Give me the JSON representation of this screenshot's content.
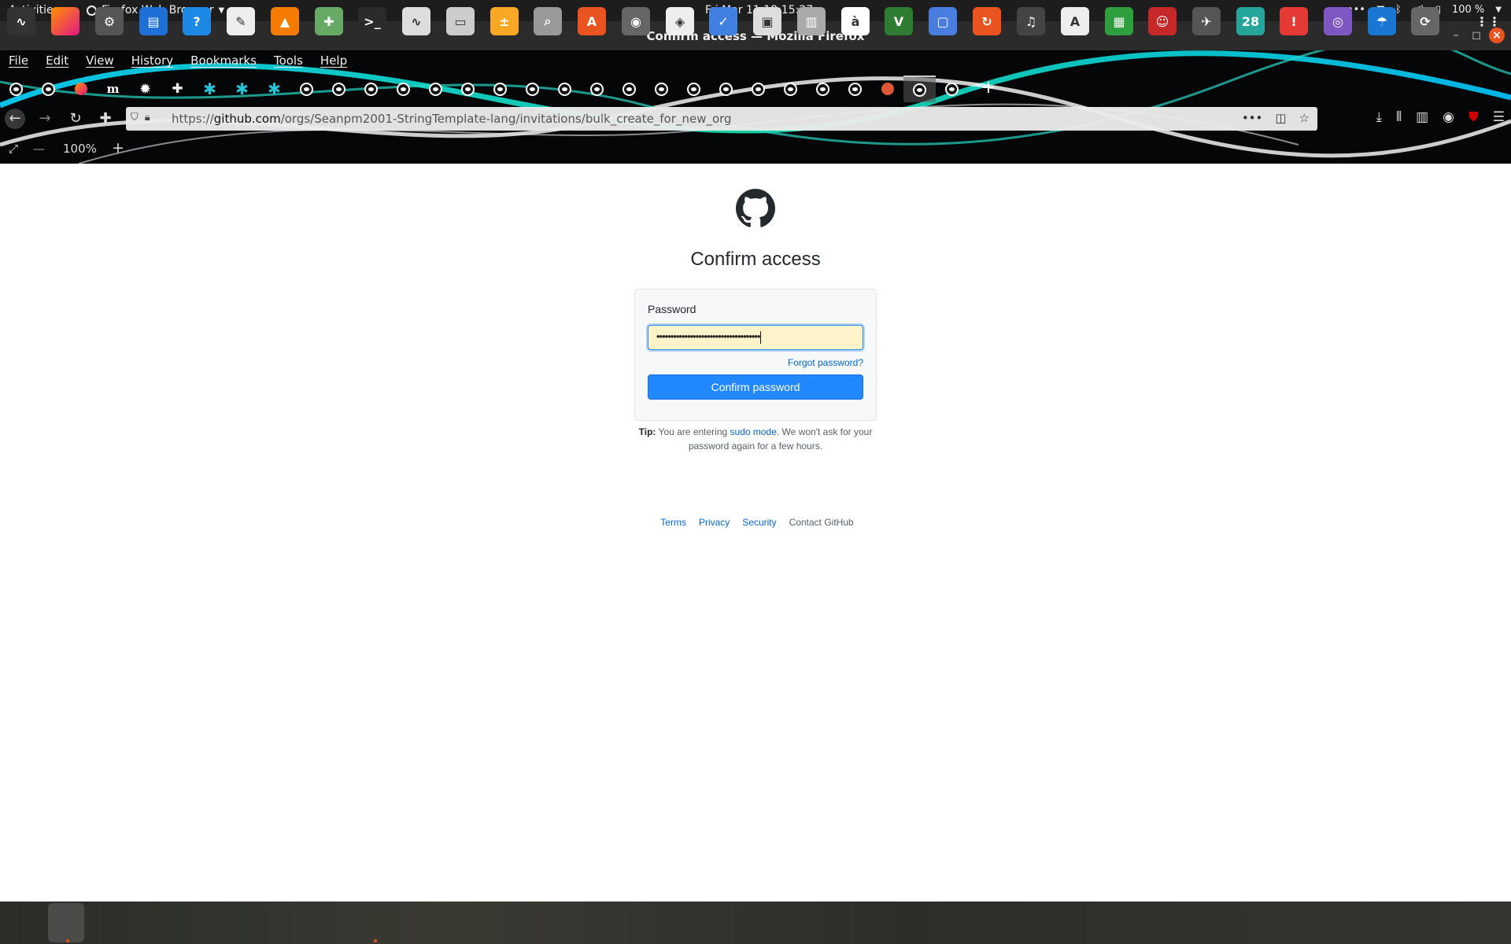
{
  "topbar": {
    "activities": "Activities",
    "app_menu": "Firefox Web Browser",
    "clock": "Fri Mar 11  18:15:27",
    "battery": "100 %"
  },
  "window": {
    "title": "Confirm access — Mozilla Firefox"
  },
  "menubar": [
    "File",
    "Edit",
    "View",
    "History",
    "Bookmarks",
    "Tools",
    "Help"
  ],
  "tabs": [
    "github",
    "github",
    "firefox",
    "m",
    "gear",
    "puzzle",
    "star",
    "star",
    "star",
    "github",
    "github",
    "github",
    "github",
    "github",
    "github",
    "github",
    "github",
    "github",
    "github",
    "github",
    "github",
    "github",
    "github",
    "github",
    "github",
    "github",
    "github",
    "ddg",
    "github-active",
    "github"
  ],
  "address": {
    "url_prefix": "https://",
    "url_domain": "github.com",
    "url_path": "/orgs/Seanpm2001-StringTemplate-lang/invitations/bulk_create_for_new_org"
  },
  "zoom": {
    "level": "100%"
  },
  "page": {
    "heading": "Confirm access",
    "password_label": "Password",
    "password_value": "•••••••••••••••••••••••••••••••••••••",
    "forgot": "Forgot password?",
    "confirm_button": "Confirm password",
    "tip_bold": "Tip:",
    "tip_pre": " You are entering ",
    "tip_link": "sudo mode",
    "tip_post": ". We won't ask for your password again for a few hours."
  },
  "footer": {
    "terms": "Terms",
    "privacy": "Privacy",
    "security": "Security",
    "contact": "Contact GitHub"
  },
  "dock_badge": "28",
  "colors": {
    "accent": "#2188ff",
    "link": "#0366d6",
    "ubuntu_orange": "#e95420"
  }
}
